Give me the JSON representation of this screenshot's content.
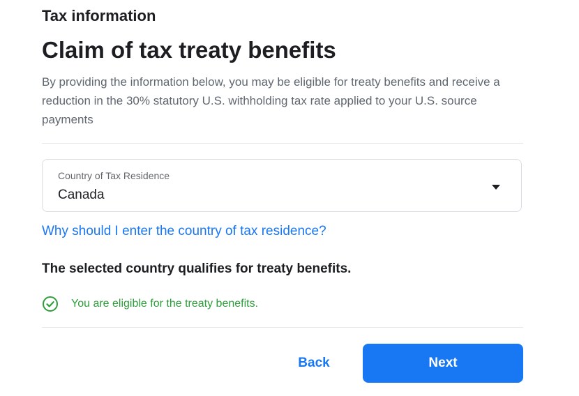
{
  "header": {
    "section_title": "Tax information",
    "page_title": "Claim of tax treaty benefits",
    "description": "By providing the information below, you may be eligible for treaty benefits and receive a reduction in the 30% statutory U.S. withholding tax rate applied to your U.S. source payments"
  },
  "country_select": {
    "label": "Country of Tax Residence",
    "value": "Canada",
    "icon": "caret-down-icon"
  },
  "help_link": "Why should I enter the country of tax residence?",
  "status": {
    "qualify_text": "The selected country qualifies for treaty benefits.",
    "eligible_text": "You are eligible for the treaty benefits.",
    "icon": "check-circle-icon",
    "color": "#2e9e3b"
  },
  "actions": {
    "back_label": "Back",
    "next_label": "Next",
    "primary_color": "#1877f2"
  }
}
